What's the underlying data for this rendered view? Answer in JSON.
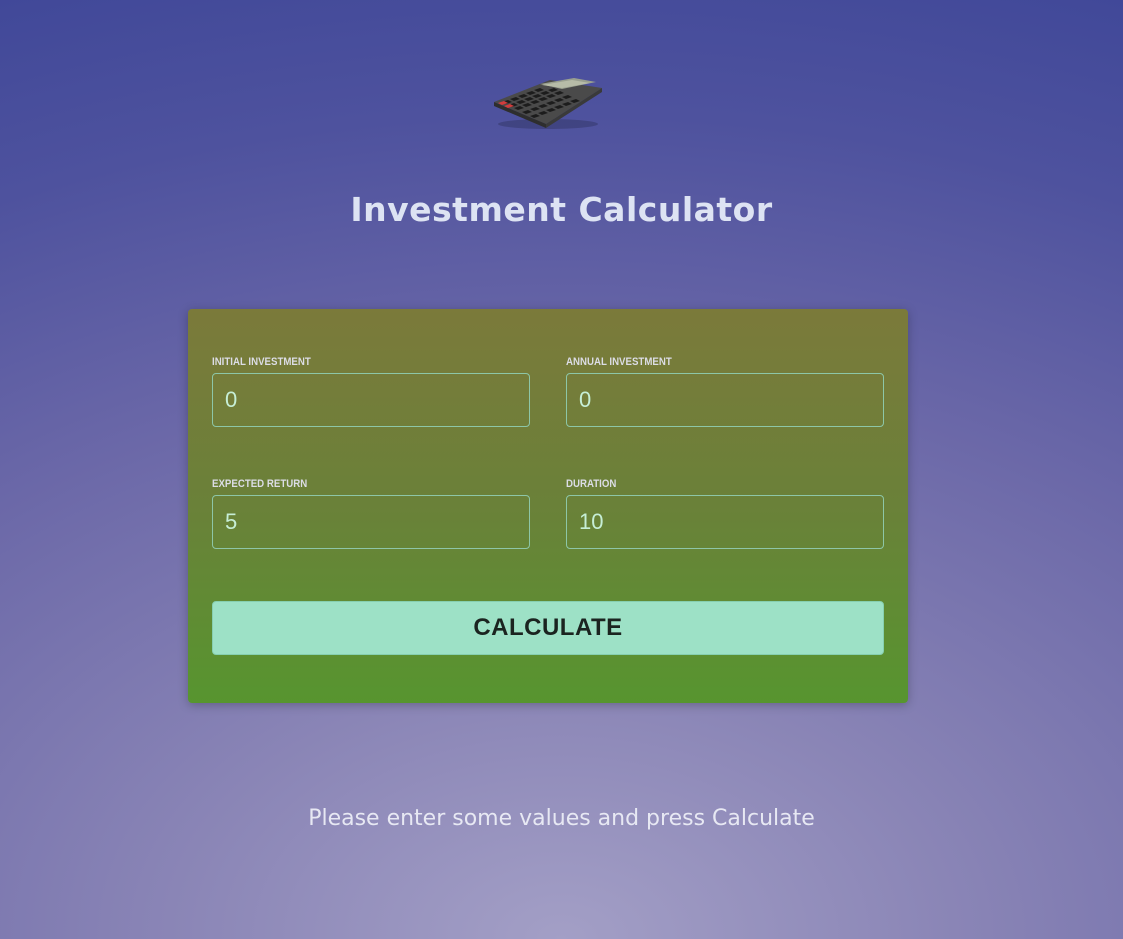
{
  "header": {
    "logo_icon": "calculator-icon",
    "title": "Investment Calculator"
  },
  "form": {
    "initial_investment": {
      "label": "Initial Investment",
      "value": "0"
    },
    "annual_investment": {
      "label": "Annual Investment",
      "value": "0"
    },
    "expected_return": {
      "label": "Expected Return",
      "value": "5"
    },
    "duration": {
      "label": "Duration",
      "value": "10"
    },
    "calculate_label": "CALCULATE"
  },
  "status": {
    "message": "Please enter some values and press Calculate"
  },
  "colors": {
    "background_top": "#3f4798",
    "background_bottom": "#a39fc6",
    "card_top": "#7b7a3a",
    "card_bottom": "#57952f",
    "button": "#9de1c6",
    "input_border": "#8dc6a7"
  }
}
